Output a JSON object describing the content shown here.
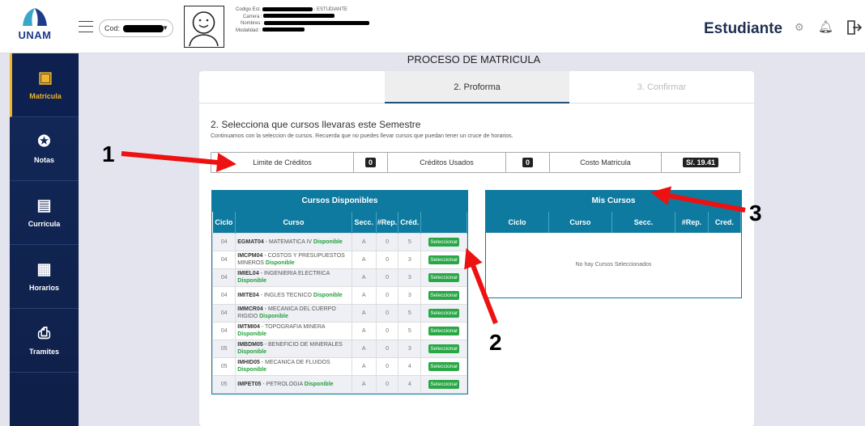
{
  "header": {
    "logo_text": "UNAM",
    "cod_label": "Cod:",
    "student_info": {
      "codigo_label": "Codigo Est.",
      "codigo_suffix": "- ESTUDIANTE",
      "carrera_label": "Carrera :",
      "nombres_label": "Nombres :",
      "modalidad_label": "Modalidad :"
    },
    "role": "Estudiante"
  },
  "sidebar": {
    "items": [
      {
        "label": "Matrícula",
        "icon": "enrollment-icon"
      },
      {
        "label": "Notas",
        "icon": "award-icon"
      },
      {
        "label": "Currícula",
        "icon": "clipboard-icon"
      },
      {
        "label": "Horarios",
        "icon": "calendar-icon"
      },
      {
        "label": "Tramites",
        "icon": "inbox-icon"
      }
    ]
  },
  "page": {
    "title": "PROCESO DE MATRICULA",
    "tabs": [
      {
        "label": ""
      },
      {
        "label": "2. Proforma"
      },
      {
        "label": "3. Confirmar"
      }
    ],
    "step_title": "2. Selecciona que cursos llevaras este Semestre",
    "step_sub": "Continuamos con la seleccion de cursos. Recuerda que no puedes llevar cursos que puedan tener un cruce de horarios."
  },
  "summary": {
    "limite_label": "Limite de Créditos",
    "limite_value": "0",
    "usados_label": "Créditos Usados",
    "usados_value": "0",
    "costo_label": "Costo Matricula",
    "costo_value": "S/. 19.41"
  },
  "disponibles": {
    "title": "Cursos Disponibles",
    "columns": [
      "Ciclo",
      "Curso",
      "Secc.",
      "#Rep.",
      "Créd."
    ],
    "button_label": "Seleccionar",
    "status_label": "Disponible",
    "rows": [
      {
        "ciclo": "04",
        "code": "EGMAT04",
        "name": "MATEMATICA IV",
        "secc": "A",
        "rep": "0",
        "cred": "5"
      },
      {
        "ciclo": "04",
        "code": "IMCPM04",
        "name": "COSTOS Y PRESUPUESTOS MINEROS",
        "secc": "A",
        "rep": "0",
        "cred": "3"
      },
      {
        "ciclo": "04",
        "code": "IMIEL04",
        "name": "INGENIERIA ELECTRICA",
        "secc": "A",
        "rep": "0",
        "cred": "3"
      },
      {
        "ciclo": "04",
        "code": "IMITE04",
        "name": "INGLES TECNICO",
        "secc": "A",
        "rep": "0",
        "cred": "3"
      },
      {
        "ciclo": "04",
        "code": "IMMCR04",
        "name": "MECANICA DEL CUERPO RIGIDO",
        "secc": "A",
        "rep": "0",
        "cred": "5"
      },
      {
        "ciclo": "04",
        "code": "IMTMI04",
        "name": "TOPOGRAFIA MINERA",
        "secc": "A",
        "rep": "0",
        "cred": "5"
      },
      {
        "ciclo": "05",
        "code": "IMBDM05",
        "name": "BENEFICIO DE MINERALES",
        "secc": "A",
        "rep": "0",
        "cred": "3"
      },
      {
        "ciclo": "05",
        "code": "IMHID05",
        "name": "MECANICA DE FLUIDOS",
        "secc": "A",
        "rep": "0",
        "cred": "4"
      },
      {
        "ciclo": "05",
        "code": "IMPET05",
        "name": "PETROLOGIA",
        "secc": "A",
        "rep": "0",
        "cred": "4"
      }
    ]
  },
  "mis_cursos": {
    "title": "Mis Cursos",
    "columns": [
      "Ciclo",
      "Curso",
      "Secc.",
      "#Rep.",
      "Cred."
    ],
    "empty_message": "No hay Cursos Seleccionados"
  },
  "annotations": [
    "1",
    "2",
    "3"
  ],
  "colors": {
    "sidebar": "#13295a",
    "table_header": "#0e7aa0",
    "accent": "#f0b429",
    "select_button": "#28a745",
    "arrow": "#ee1111"
  }
}
